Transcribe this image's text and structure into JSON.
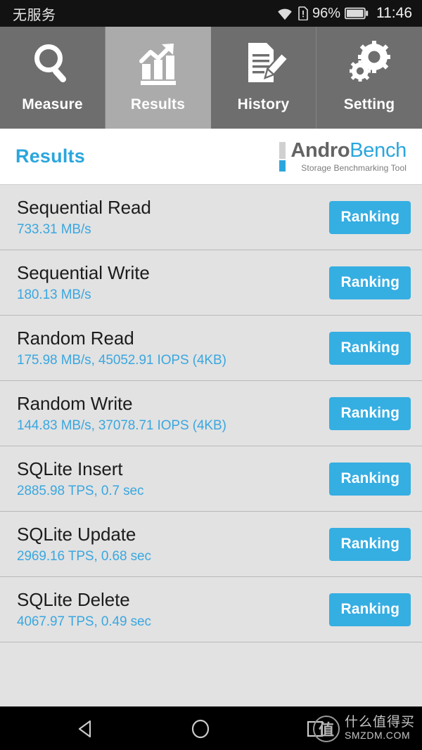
{
  "statusbar": {
    "carrier": "无服务",
    "wifi_icon": "wifi-icon",
    "sim_alert_icon": "sim-card-alert-icon",
    "battery_percent": "96%",
    "battery_icon": "battery-icon",
    "clock": "11:46"
  },
  "tabs": [
    {
      "label": "Measure",
      "icon": "magnifier-icon",
      "active": false
    },
    {
      "label": "Results",
      "icon": "bar-chart-trend-icon",
      "active": true
    },
    {
      "label": "History",
      "icon": "document-pencil-icon",
      "active": false
    },
    {
      "label": "Setting",
      "icon": "gears-icon",
      "active": false
    }
  ],
  "header": {
    "title": "Results",
    "logo": {
      "name_part1": "Andro",
      "name_part2": "Bench",
      "tagline": "Storage Benchmarking Tool"
    }
  },
  "results": {
    "ranking_label": "Ranking",
    "rows": [
      {
        "title": "Sequential Read",
        "value": "733.31 MB/s"
      },
      {
        "title": "Sequential Write",
        "value": "180.13 MB/s"
      },
      {
        "title": "Random Read",
        "value": "175.98 MB/s, 45052.91 IOPS (4KB)"
      },
      {
        "title": "Random Write",
        "value": "144.83 MB/s, 37078.71 IOPS (4KB)"
      },
      {
        "title": "SQLite Insert",
        "value": "2885.98 TPS, 0.7 sec"
      },
      {
        "title": "SQLite Update",
        "value": "2969.16 TPS, 0.68 sec"
      },
      {
        "title": "SQLite Delete",
        "value": "4067.97 TPS, 0.49 sec"
      }
    ]
  },
  "navbar": {
    "back_icon": "back-triangle-icon",
    "home_icon": "home-circle-icon",
    "recents_icon": "recents-square-icon",
    "watermark": {
      "logo_char": "值",
      "cn": "什么值得买",
      "en": "SMZDM.COM"
    }
  },
  "colors": {
    "accent_blue": "#35aee2",
    "header_blue": "#2ba6dd",
    "tab_inactive": "#6e6e6e",
    "tab_active": "#ababab",
    "row_bg": "#e2e2e2"
  }
}
